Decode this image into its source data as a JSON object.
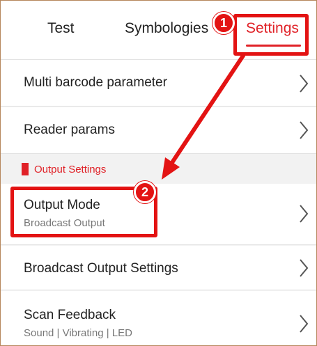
{
  "tabs": [
    {
      "label": "Test"
    },
    {
      "label": "Symbologies"
    },
    {
      "label": "Settings"
    }
  ],
  "settings": {
    "rows": [
      {
        "title": "Multi barcode parameter"
      },
      {
        "title": "Reader params"
      }
    ],
    "section": {
      "label": "Output Settings"
    },
    "output_rows": [
      {
        "title": "Output Mode",
        "subtitle": "Broadcast Output"
      },
      {
        "title": "Broadcast Output Settings"
      },
      {
        "title": "Scan Feedback",
        "subtitle": "Sound | Vibrating | LED"
      }
    ]
  },
  "annotations": {
    "step1": "1",
    "step2": "2"
  },
  "colors": {
    "accent": "#e02127",
    "annotation": "#e31313"
  },
  "icons": [
    "chevron-right-icon"
  ]
}
